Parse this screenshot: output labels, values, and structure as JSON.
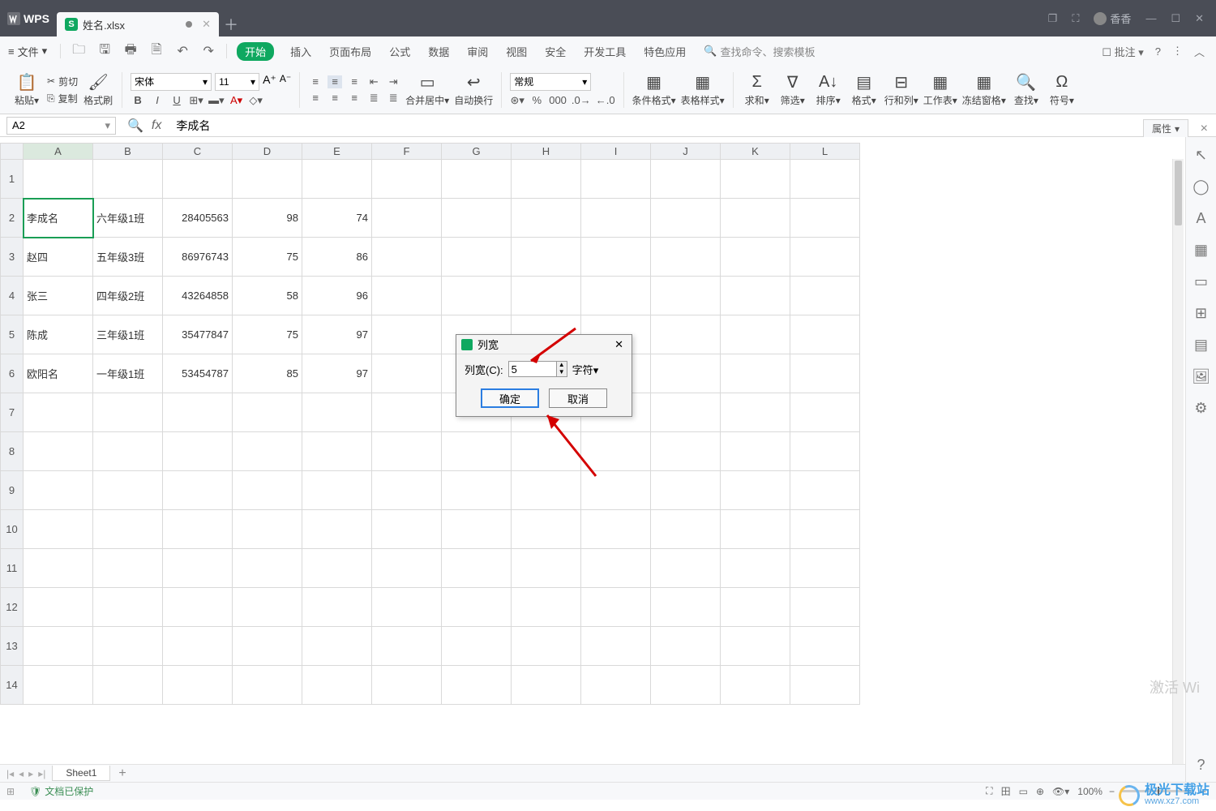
{
  "title": {
    "app": "WPS",
    "filename": "姓名.xlsx",
    "user": "香香"
  },
  "menu": {
    "file": "文件",
    "tabs": [
      "开始",
      "插入",
      "页面布局",
      "公式",
      "数据",
      "审阅",
      "视图",
      "安全",
      "开发工具",
      "特色应用"
    ],
    "search": "查找命令、搜索模板",
    "annot": "批注"
  },
  "ribbon": {
    "paste": "粘贴",
    "cut": "剪切",
    "copy": "复制",
    "fmtpaint": "格式刷",
    "font": "宋体",
    "size": "11",
    "merge": "合并居中",
    "wrap": "自动换行",
    "numfmt": "常规",
    "condfmt": "条件格式",
    "tblstyle": "表格样式",
    "sum": "求和",
    "filter": "筛选",
    "sort": "排序",
    "format": "格式",
    "rowcol": "行和列",
    "sheet": "工作表",
    "freeze": "冻结窗格",
    "find": "查找",
    "symbol": "符号"
  },
  "fx": {
    "cell": "A2",
    "value": "李成名"
  },
  "prop": "属性",
  "cols": [
    "A",
    "B",
    "C",
    "D",
    "E",
    "F",
    "G",
    "H",
    "I",
    "J",
    "K",
    "L"
  ],
  "rows": [
    "1",
    "2",
    "3",
    "4",
    "5",
    "6",
    "7",
    "8",
    "9",
    "10",
    "11",
    "12",
    "13",
    "14"
  ],
  "data": [
    {
      "a": "李成名",
      "b": "六年级1班",
      "c": "28405563",
      "d": "98",
      "e": "74"
    },
    {
      "a": "赵四",
      "b": "五年级3班",
      "c": "86976743",
      "d": "75",
      "e": "86"
    },
    {
      "a": "张三",
      "b": "四年级2班",
      "c": "43264858",
      "d": "58",
      "e": "96"
    },
    {
      "a": "陈成",
      "b": "三年级1班",
      "c": "35477847",
      "d": "75",
      "e": "97"
    },
    {
      "a": "欧阳名",
      "b": "一年级1班",
      "c": "53454787",
      "d": "85",
      "e": "97"
    }
  ],
  "dialog": {
    "title": "列宽",
    "label": "列宽(C):",
    "value": "5",
    "unit": "字符",
    "ok": "确定",
    "cancel": "取消"
  },
  "sheetname": "Sheet1",
  "status": {
    "protected": "文档已保护",
    "zoom": "100%"
  },
  "wm": {
    "activate": "激活 Wi",
    "site": "极光下载站",
    "url": "www.xz7.com"
  }
}
